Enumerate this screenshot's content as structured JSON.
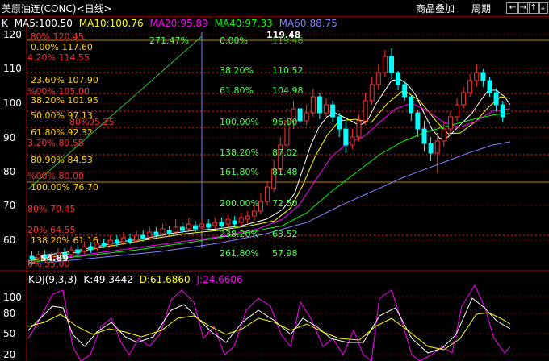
{
  "window": {
    "title": "美原油连(CONC)<日线>",
    "menu": {
      "overlay": "商品叠加",
      "period": "周期"
    },
    "nav_buttons": [
      "←",
      "→",
      "↑",
      "↓"
    ]
  },
  "main_chart": {
    "type": "candlestick",
    "series_label": "K",
    "ma_legend": [
      {
        "label": "MA5:100.50",
        "color": "#ffffff"
      },
      {
        "label": "MA10:100.76",
        "color": "#ffff00"
      },
      {
        "label": "MA20:95.89",
        "color": "#ff00ff"
      },
      {
        "label": "MA40:97.33",
        "color": "#00ff00"
      },
      {
        "label": "MA60:88.75",
        "color": "#8080ff"
      }
    ],
    "y_ticks": [
      "120",
      "110",
      "100",
      "90",
      "80",
      "70",
      "60"
    ],
    "high_marker": "119.48",
    "low_marker": "54.89",
    "fib_left": [
      "0.00% 117.60",
      "23.60% 107.90",
      "38.20% 101.95",
      "50.00% 97.13",
      "61.80% 92.32",
      "80.90% 84.53",
      "100.00% 76.70",
      "138.20% 61.16"
    ],
    "red_ext": [
      ".80% 120.45",
      "4.20% 114.55",
      "%00% 105.00",
      "3.20% 89.55",
      "%00% 80.00",
      "80% 70.45",
      "20% 64.55",
      "0% 55.00"
    ],
    "fib_mid_pct": [
      "0.00%",
      "38.20%",
      "61.80%",
      "100.00%",
      "138.20%",
      "161.80%",
      "200.00%",
      "238.20%",
      "261.80%"
    ],
    "fib_mid_val": [
      "119.48",
      "110.52",
      "104.98",
      "96.00",
      "87.02",
      "81.48",
      "72.50",
      "63.52",
      "57.98"
    ],
    "gann_label": "271.47%",
    "overlap_labels": [
      "80%",
      "95.25"
    ]
  },
  "kdj_chart": {
    "label": "KDJ(9,3,3)",
    "k": "K:49.3442",
    "d": "D:61.6860",
    "j": "J:24.6606",
    "y_ticks": [
      "100",
      "80",
      "50",
      "20"
    ]
  },
  "colors": {
    "up": "#ff3232",
    "down": "#00ffff",
    "grid": "#7a0000",
    "fib_red": "#ffd200",
    "fib_green": "#4cff4c"
  }
}
